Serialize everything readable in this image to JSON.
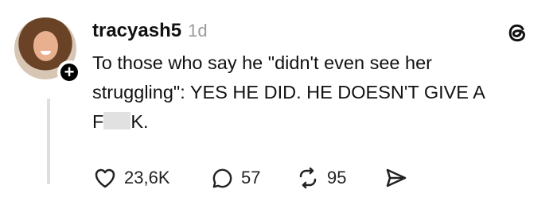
{
  "post": {
    "username": "tracyash5",
    "timestamp": "1d",
    "text_line1": "To those who say he \"didn't even see her",
    "text_line2": "struggling\": YES HE DID. HE DOESN'T GIVE A",
    "text_line3_start": "F",
    "text_line3_end": "K."
  },
  "actions": {
    "likes": "23,6K",
    "replies": "57",
    "reposts": "95"
  },
  "icons": [
    "heart-icon",
    "comment-icon",
    "repost-icon",
    "share-icon",
    "threads-logo-icon"
  ]
}
